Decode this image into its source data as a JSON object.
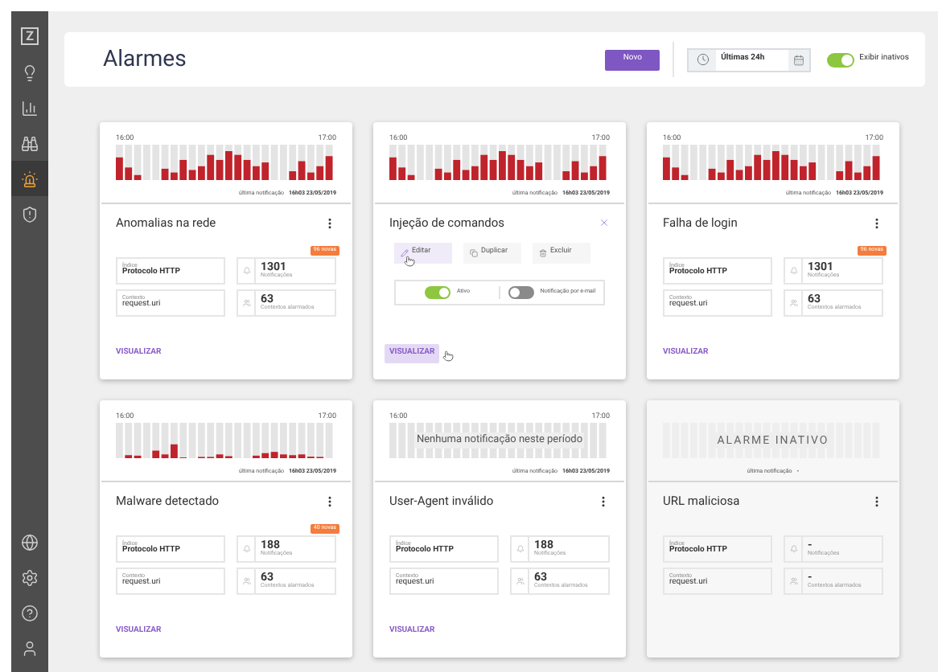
{
  "sidebar": {
    "logo": "Z",
    "items": [
      {
        "selected": false
      },
      {
        "selected": false
      },
      {
        "selected": false
      },
      {
        "selected": true
      },
      {
        "selected": false
      }
    ],
    "bottom_items": [
      {
        "selected": false
      },
      {
        "selected": false
      },
      {
        "selected": false
      },
      {
        "selected": false
      }
    ]
  },
  "header": {
    "title": "Alarmes",
    "new_button": "Novo",
    "period": "Últimas 24h",
    "show_inactive": {
      "label": "Exibir inativos",
      "on": true
    }
  },
  "cards": [
    {
      "title": "Anomalias na rede",
      "kind": "activity",
      "start": "16:00",
      "end": "17:00",
      "last_label": "última notificação",
      "last_value": "16h03 23/05/2019",
      "index_label": "Índice",
      "index_value": "Protocolo HTTP",
      "context_label": "Contexto",
      "context_value": "request.uri",
      "notifications": "1301",
      "notifications_label": "Notificações",
      "badge": "96 novas",
      "contexts": "63",
      "contexts_label": "Contextos alarmados",
      "action": "VISUALIZAR",
      "action_hovered": false,
      "inactive": false
    },
    {
      "title": "Injeção de comandos",
      "kind": "activity",
      "start": "16:00",
      "end": "17:00",
      "last_label": "última notificação",
      "last_value": "16h03 23/05/2019",
      "menu": {
        "actions": [
          {
            "label": "Editar",
            "hovered": true
          },
          {
            "label": "Duplicar",
            "hovered": false
          },
          {
            "label": "Excluir",
            "hovered": false
          }
        ],
        "toggles": [
          {
            "label": "Ativo",
            "on": true
          },
          {
            "label": "Notificação por e-mail",
            "on": false
          }
        ]
      },
      "action": "VISUALIZAR",
      "action_hovered": true,
      "inactive": false
    },
    {
      "title": "Falha de login",
      "kind": "activity",
      "start": "16:00",
      "end": "17:00",
      "last_label": "última notificação",
      "last_value": "16h03 23/05/2019",
      "index_label": "Índice",
      "index_value": "Protocolo HTTP",
      "context_label": "Contexto",
      "context_value": "request.uri",
      "notifications": "1301",
      "notifications_label": "Notificações",
      "badge": "96 novas",
      "contexts": "63",
      "contexts_label": "Contextos alarmados",
      "action": "VISUALIZAR",
      "action_hovered": false,
      "inactive": false
    },
    {
      "title": "Malware detectado",
      "kind": "sparse",
      "start": "16:00",
      "end": "17:00",
      "last_label": "última notificação",
      "last_value": "16h03 23/05/2019",
      "index_label": "Índice",
      "index_value": "Protocolo HTTP",
      "context_label": "Contexto",
      "context_value": "request.uri",
      "notifications": "188",
      "notifications_label": "Notificações",
      "badge": "40 novas",
      "contexts": "63",
      "contexts_label": "Contextos alarmados",
      "action": "VISUALIZAR",
      "action_hovered": false,
      "inactive": false
    },
    {
      "title": "User-Agent inválido",
      "kind": "empty",
      "chart_message": "Nenhuma notificação neste período",
      "start": "16:00",
      "end": "17:00",
      "last_label": "última notificação",
      "last_value": "16h03 23/05/2019",
      "index_label": "Índice",
      "index_value": "Protocolo HTTP",
      "context_label": "Contexto",
      "context_value": "request.uri",
      "notifications": "188",
      "notifications_label": "Notificações",
      "contexts": "63",
      "contexts_label": "Contextos alarmados",
      "action": "VISUALIZAR",
      "action_hovered": false,
      "inactive": false
    },
    {
      "title": "URL maliciosa",
      "kind": "empty",
      "chart_message": "ALARME INATIVO",
      "last_label": "última notificação",
      "last_value": "-",
      "index_label": "Índice",
      "index_value": "Protocolo HTTP",
      "context_label": "Contexto",
      "context_value": "request.uri",
      "notifications": "-",
      "notifications_label": "Notificações",
      "contexts": "-",
      "contexts_label": "Contextos alarmados",
      "inactive": true
    }
  ]
}
